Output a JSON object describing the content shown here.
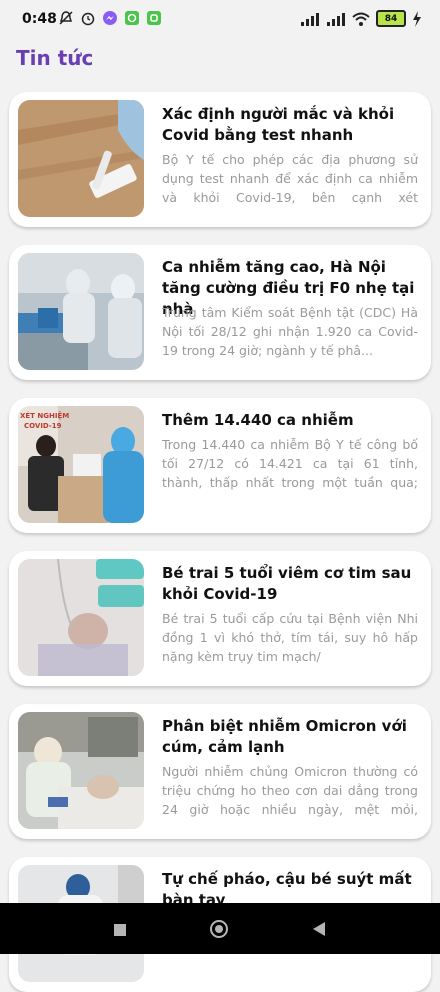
{
  "status": {
    "time": "0:48",
    "battery": "84"
  },
  "header": {
    "title": "Tin tức"
  },
  "articles": [
    {
      "title": "Xác định người mắc và khỏi Covid bằng test nhanh",
      "summary": "Bộ Y tế cho phép các địa phương sử dụng test nhanh để xác định ca nhiễm và khỏi Covid-19, bên cạnh xét nghiệm..."
    },
    {
      "title": "Ca nhiễm tăng cao, Hà Nội tăng cường điều trị F0 nhẹ tại nhà",
      "summary": "Trung tâm Kiểm soát Bệnh tật (CDC) Hà Nội tối 28/12 ghi nhận 1.920 ca Covid-19 trong 24 giờ; ngành y tế phâ..."
    },
    {
      "title": "Thêm 14.440 ca nhiễm",
      "summary": "Trong 14.440 ca nhiễm Bộ Y tế công bố tối 27/12 có 14.421 ca tại 61 tỉnh, thành, thấp nhất trong một tuần qua; Hà Nội..."
    },
    {
      "title": "Bé trai 5 tuổi viêm cơ tim sau khỏi Covid-19",
      "summary": "Bé trai 5 tuổi cấp cứu tại Bệnh viện Nhi đồng 1 vì khó thở, tím tái, suy hô hấp nặng kèm trụy tim mạch/"
    },
    {
      "title": "Phân biệt nhiễm Omicron với cúm, cảm lạnh",
      "summary": "Người nhiễm chủng Omicron thường có triệu chứng ho theo cơn dai dẳng trong 24 giờ hoặc nhiều ngày, mệt mỏi, nghẹ..."
    },
    {
      "title": "Tự chế pháo, cậu bé suýt mất bàn tay",
      "summary": ""
    }
  ],
  "colors": {
    "accent": "#6a3fb3",
    "card_bg": "#ffffff",
    "page_bg": "#f2f2f2"
  }
}
